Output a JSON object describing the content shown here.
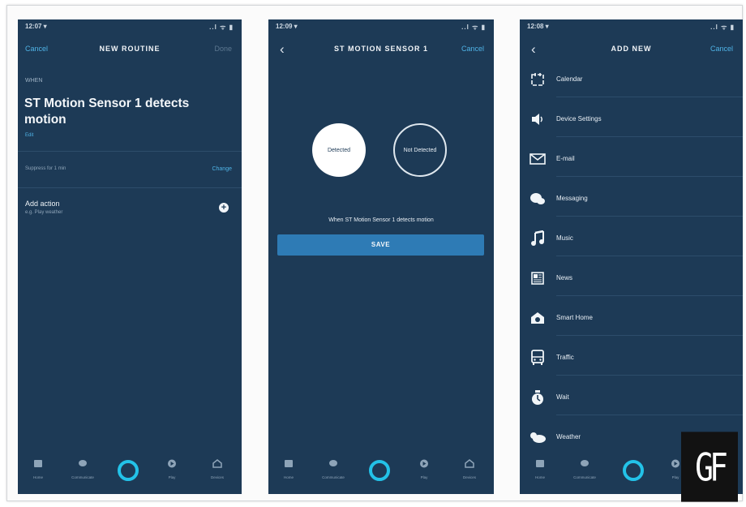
{
  "colors": {
    "panel_bg": "#1d3a56",
    "accent": "#4fb3e6",
    "save_button": "#2e7bb5",
    "alexa_ring": "#23c2e8",
    "frame_bg": "#fbfbfb"
  },
  "phone1": {
    "status_time": "12:07 ▾",
    "status_signal": "..l ᯤ ▮",
    "nav": {
      "cancel": "Cancel",
      "title": "NEW ROUTINE",
      "done": "Done"
    },
    "when_label": "WHEN",
    "trigger_title": "ST Motion Sensor 1 detects motion",
    "trigger_sub": "Edit",
    "suppress_text": "Suppress for 1 min",
    "change_link": "Change",
    "add_action_label": "Add action",
    "add_action_sub": "e.g. Play weather",
    "plus_icon": "+"
  },
  "phone2": {
    "status_time": "12:09 ▾",
    "status_signal": "..l ᯤ ▮",
    "nav": {
      "back_icon": "‹",
      "title": "ST MOTION SENSOR 1",
      "cancel": "Cancel"
    },
    "option_detected": "Detected",
    "option_not_detected": "Not Detected",
    "when_text": "When ST Motion Sensor 1 detects motion",
    "save_label": "SAVE"
  },
  "phone3": {
    "status_time": "12:08 ▾",
    "status_signal": "..l ᯤ ▮",
    "nav": {
      "back_icon": "‹",
      "title": "ADD NEW",
      "cancel": "Cancel"
    },
    "items": [
      {
        "label": "Calendar",
        "icon": "calendar-icon"
      },
      {
        "label": "Device Settings",
        "icon": "speaker-icon"
      },
      {
        "label": "E-mail",
        "icon": "envelope-icon"
      },
      {
        "label": "Messaging",
        "icon": "chat-bubble-icon"
      },
      {
        "label": "Music",
        "icon": "music-note-icon"
      },
      {
        "label": "News",
        "icon": "newspaper-icon"
      },
      {
        "label": "Smart Home",
        "icon": "smart-home-icon"
      },
      {
        "label": "Traffic",
        "icon": "bus-icon"
      },
      {
        "label": "Wait",
        "icon": "timer-icon"
      },
      {
        "label": "Weather",
        "icon": "cloud-icon"
      }
    ]
  },
  "tabbar": {
    "tabs": [
      {
        "label": "Home",
        "icon": "home-icon"
      },
      {
        "label": "Communicate",
        "icon": "chat-icon"
      },
      {
        "label": "Alexa",
        "icon": "alexa-ring-icon"
      },
      {
        "label": "Play",
        "icon": "play-icon"
      },
      {
        "label": "Devices",
        "icon": "devices-icon"
      }
    ]
  },
  "watermark": "GF"
}
